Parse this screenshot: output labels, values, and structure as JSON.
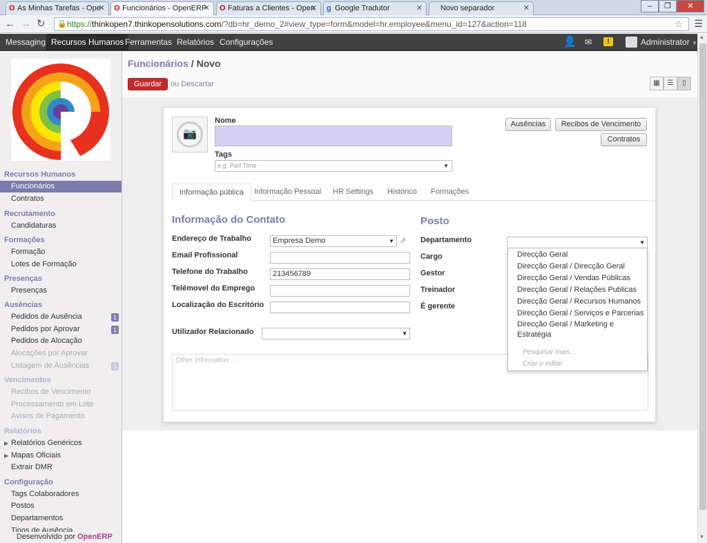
{
  "browser": {
    "tabs": [
      {
        "title": "As Minhas Tarefas - Ope",
        "icon": "opera-icon"
      },
      {
        "title": "Funcionários - OpenERP",
        "icon": "opera-icon"
      },
      {
        "title": "Faturas a Clientes - Open",
        "icon": "opera-icon"
      },
      {
        "title": "Google Tradutor",
        "icon": "google-icon"
      },
      {
        "title": "Novo separador",
        "icon": ""
      }
    ],
    "url_scheme": "https://",
    "url_host": "thinkopen7.thinkopensolutions.com",
    "url_path": "/?db=hr_demo_2#view_type=form&model=hr.employee&menu_id=127&action=118"
  },
  "topbar": {
    "menus": [
      "Messaging",
      "Recursos Humanos",
      "Ferramentas",
      "Relatórios",
      "Configurações"
    ],
    "user": "Administrator"
  },
  "sidebar": {
    "sections": [
      {
        "title": "Recursos Humanos",
        "items": [
          "Funcionários",
          "Contratos"
        ]
      },
      {
        "title": "Recrutamento",
        "items": [
          "Candidaturas"
        ]
      },
      {
        "title": "Formações",
        "items": [
          "Formação",
          "Lotes de Formação"
        ]
      },
      {
        "title": "Presenças",
        "items": [
          "Presenças"
        ]
      },
      {
        "title": "Ausências",
        "items": [
          "Pedidos de Ausência",
          "Pedidos por Aprovar",
          "Pedidos de Alocação",
          "Alocações por Aprovar",
          "Listagem de Ausências"
        ]
      },
      {
        "title": "Vencimentos",
        "items": [
          "Recibos de Vencimento",
          "Processamento em Lote",
          "Avisos de Pagamento"
        ]
      },
      {
        "title": "Relatórios",
        "items": [
          "Relatórios Genéricos",
          "Mapas Oficiais",
          "Extrair DMR"
        ]
      },
      {
        "title": "Configuração",
        "items": [
          "Tags Colaboradores",
          "Postos",
          "Departamentos",
          "Tipos de Ausência"
        ]
      }
    ],
    "badges": {
      "pedidos_ausencia": "1",
      "pedidos_aprovar": "1",
      "listagem": "1"
    },
    "footer_prefix": "Desenvolvido por",
    "footer_brand": "OpenERP"
  },
  "header": {
    "crumb_parent": "Funcionários",
    "crumb_sep": " / ",
    "crumb_current": "Novo",
    "save_label": "Guardar",
    "discard_prefix": "ou",
    "discard_label": "Descartar"
  },
  "form": {
    "name_label": "Nome",
    "tags_label": "Tags",
    "tags_placeholder": "e.g. Part Time",
    "buttons": {
      "ausencias": "Ausências",
      "recibos": "Recibos de Vencimento",
      "contratos": "Contratos"
    },
    "tabs": [
      "Informação pública",
      "Informação Pessoal",
      "HR Settings",
      "Histórico",
      "Formações"
    ],
    "contact_title": "Informação do Contato",
    "contact_fields": {
      "work_address_label": "Endereço de Trabalho",
      "work_address_value": "Empresa Demo",
      "email_label": "Email Profissional",
      "email_value": "",
      "phone_label": "Telefone do Trabalho",
      "phone_value": "213456789",
      "mobile_label": "Telémovel do Emprego",
      "mobile_value": "",
      "office_label": "Localização do Escritório",
      "office_value": ""
    },
    "user_label": "Utilizador Relacionado",
    "post_title": "Posto",
    "post_fields": {
      "dept": "Departamento",
      "cargo": "Cargo",
      "gestor": "Gestor",
      "treinador": "Treinador",
      "gerente": "É gerente"
    },
    "notes_placeholder": "Other Information ..."
  },
  "dropdown": {
    "options": [
      "Direcção Geral",
      "Direcção Geral / Direcção Geral",
      "Direcção Geral / Vendas Públicas",
      "Direcção Geral / Relações Publicas",
      "Direcção Geral / Recursos Humanos",
      "Direcção Geral / Serviços e Parcerias",
      "Direcção Geral / Marketing e",
      "Estratégia"
    ],
    "search_more": "Pesquisar mais...",
    "create_edit": "Criar e editar"
  }
}
